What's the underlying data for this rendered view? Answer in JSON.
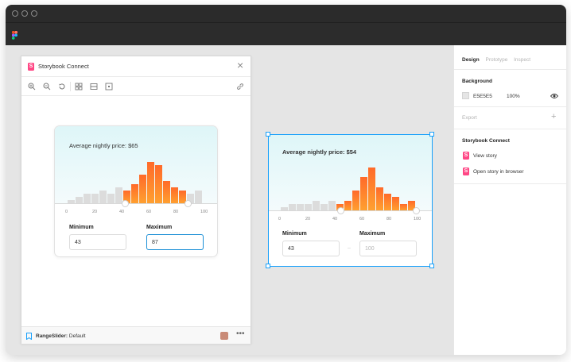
{
  "plugin": {
    "title": "Storybook Connect",
    "storybook_glyph": "S",
    "toolbar_icons": [
      "zoom-in-icon",
      "zoom-out-icon",
      "reset-zoom-icon",
      "grid-icon",
      "layout-icon",
      "frame-icon",
      "link-icon"
    ],
    "footer": {
      "component": "RangeSlider:",
      "story": " Default",
      "more": "•••"
    }
  },
  "card_left": {
    "heading": "Average nightly price:",
    "price": "$65",
    "ticks": [
      "0",
      "20",
      "40",
      "60",
      "80",
      "100"
    ],
    "min_label": "Minimum",
    "max_label": "Maximum",
    "min_value": "43",
    "max_value": "87"
  },
  "card_right": {
    "heading": "Average nightly price: $54",
    "ticks": [
      "0",
      "20",
      "40",
      "60",
      "80",
      "100"
    ],
    "min_label": "Minimum",
    "max_label": "Maximum",
    "min_value": "43",
    "max_placeholder": "100",
    "dash": "–"
  },
  "chart_data": [
    {
      "type": "bar",
      "categories": [
        "0",
        "6",
        "12",
        "18",
        "24",
        "30",
        "36",
        "42",
        "48",
        "54",
        "60",
        "66",
        "72",
        "78",
        "84",
        "90",
        "96"
      ],
      "values": [
        1,
        2,
        3,
        3,
        4,
        3,
        5,
        4,
        6,
        9,
        13,
        12,
        7,
        5,
        4,
        3,
        4
      ],
      "selected_range": [
        43,
        87
      ],
      "xlim": [
        0,
        100
      ],
      "highlight_color": "#ff6a2a",
      "muted_color": "#dcdcdc"
    },
    {
      "type": "bar",
      "categories": [
        "0",
        "6",
        "12",
        "18",
        "24",
        "30",
        "36",
        "42",
        "48",
        "54",
        "60",
        "66",
        "72",
        "78",
        "84",
        "90",
        "96"
      ],
      "values": [
        1,
        2,
        2,
        2,
        3,
        2,
        3,
        2,
        3,
        6,
        10,
        13,
        7,
        5,
        4,
        2,
        3
      ],
      "selected_range": [
        43,
        100
      ],
      "xlim": [
        0,
        100
      ],
      "highlight_color": "#ff6a2a",
      "muted_color": "#dcdcdc"
    }
  ],
  "right_panel": {
    "tabs": [
      "Design",
      "Prototype",
      "Inspect"
    ],
    "background_title": "Background",
    "bg_hex": "E5E5E5",
    "bg_opacity": "100%",
    "export_title": "Export",
    "export_plus": "+",
    "storybook_title": "Storybook Connect",
    "links": [
      "View story",
      "Open story in browser"
    ]
  },
  "colors": {
    "accent": "#18a0fb",
    "storybook": "#ff4785",
    "bar_hot": "#ff6a2a"
  }
}
